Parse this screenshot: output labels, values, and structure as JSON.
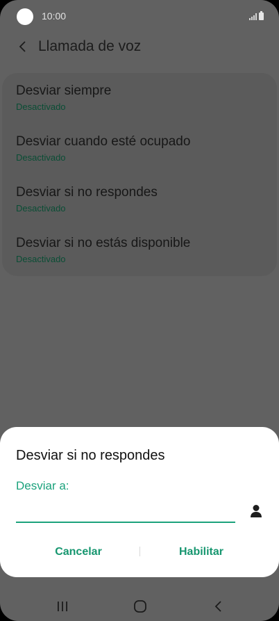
{
  "status_bar": {
    "time": "10:00",
    "icons": [
      "signal-icon",
      "battery-icon"
    ]
  },
  "header": {
    "title": "Llamada de voz",
    "back_icon": "chevron-left-icon"
  },
  "settings": {
    "items": [
      {
        "title": "Desviar siempre",
        "status": "Desactivado"
      },
      {
        "title": "Desviar cuando esté ocupado",
        "status": "Desactivado"
      },
      {
        "title": "Desviar si no respondes",
        "status": "Desactivado"
      },
      {
        "title": "Desviar si no estás disponible",
        "status": "Desactivado"
      }
    ]
  },
  "dialog": {
    "title": "Desviar si no respondes",
    "field_label": "Desviar a:",
    "field_value": "",
    "contact_icon": "person-icon",
    "cancel_label": "Cancelar",
    "enable_label": "Habilitar"
  },
  "nav_bar": {
    "icons": [
      "recent-apps-icon",
      "home-icon",
      "back-icon"
    ]
  },
  "colors": {
    "accent": "#1ba27c",
    "dim_background": "#616161",
    "status_text": "#0a4d35"
  }
}
